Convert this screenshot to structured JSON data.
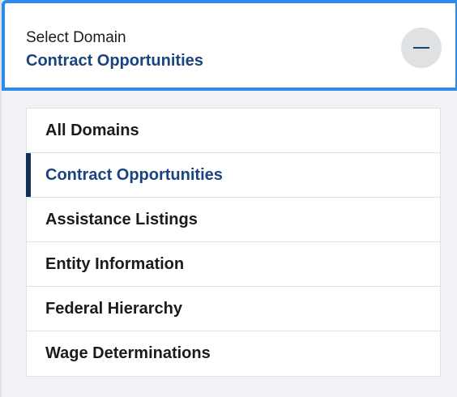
{
  "header": {
    "label": "Select Domain",
    "selected": "Contract Opportunities",
    "collapse_icon": "minus-icon"
  },
  "domains": [
    {
      "label": "All Domains",
      "active": false
    },
    {
      "label": "Contract Opportunities",
      "active": true
    },
    {
      "label": "Assistance Listings",
      "active": false
    },
    {
      "label": "Entity Information",
      "active": false
    },
    {
      "label": "Federal Hierarchy",
      "active": false
    },
    {
      "label": "Wage Determinations",
      "active": false
    }
  ],
  "colors": {
    "accent_border": "#2e8bec",
    "selected_text": "#1a4480",
    "active_indicator": "#162e51"
  }
}
